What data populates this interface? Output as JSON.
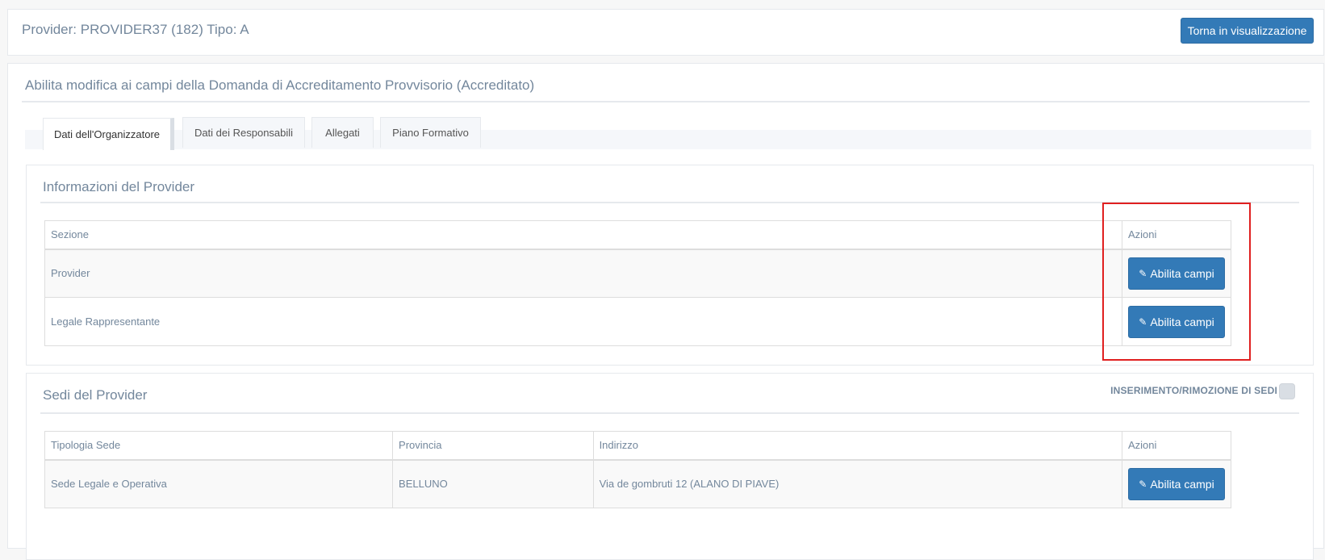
{
  "header": {
    "title": "Provider: PROVIDER37 (182) Tipo: A",
    "back_button": "Torna in visualizzazione"
  },
  "main": {
    "title": "Abilita modifica ai campi della Domanda di Accreditamento Provvisorio (Accreditato)",
    "tabs": [
      {
        "label": "Dati dell'Organizzatore",
        "active": true
      },
      {
        "label": "Dati dei Responsabili",
        "active": false
      },
      {
        "label": "Allegati",
        "active": false
      },
      {
        "label": "Piano Formativo",
        "active": false
      }
    ]
  },
  "info_section": {
    "title": "Informazioni del Provider",
    "columns": [
      "Sezione",
      "Azioni"
    ],
    "rows": [
      {
        "sezione": "Provider",
        "action": "Abilita campi"
      },
      {
        "sezione": "Legale Rappresentante",
        "action": "Abilita campi"
      }
    ]
  },
  "sedi_section": {
    "title": "Sedi del Provider",
    "toggle_label": "INSERIMENTO/RIMOZIONE DI SEDI",
    "toggle_checked": false,
    "columns": [
      "Tipologia Sede",
      "Provincia",
      "Indirizzo",
      "Azioni"
    ],
    "rows": [
      {
        "tipologia": "Sede Legale e Operativa",
        "provincia": "BELLUNO",
        "indirizzo": "Via de gombruti 12 (ALANO DI PIAVE)",
        "action": "Abilita campi"
      }
    ]
  },
  "icons": {
    "edit": "pencil-icon"
  },
  "colors": {
    "primary_button": "#337ab7",
    "highlight": "#e02020",
    "text": "#73879c"
  }
}
